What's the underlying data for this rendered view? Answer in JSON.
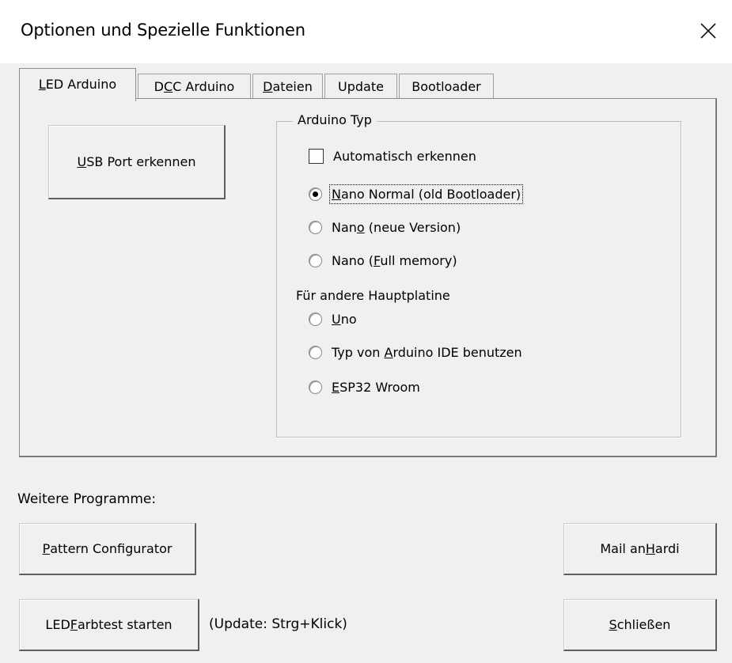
{
  "window": {
    "title": "Optionen und Spezielle Funktionen",
    "close_icon": "close-icon"
  },
  "tabs": [
    {
      "pre": "",
      "key": "L",
      "post": "ED Arduino",
      "active": true
    },
    {
      "pre": "D",
      "key": "C",
      "post": "C Arduino",
      "active": false
    },
    {
      "pre": "",
      "key": "D",
      "post": "ateien",
      "active": false
    },
    {
      "pre": "",
      "key": "",
      "post": "Update",
      "active": false
    },
    {
      "pre": "",
      "key": "",
      "post": "Bootloader",
      "active": false
    }
  ],
  "usb_button": {
    "pre": "",
    "key": "U",
    "post": "SB Port erkennen"
  },
  "arduino_type": {
    "legend": "Arduino Typ",
    "auto_detect": {
      "label": "Automatisch erkennen",
      "checked": false
    },
    "options": [
      {
        "pre": "",
        "key": "N",
        "post": "ano Normal (old Bootloader)",
        "checked": true
      },
      {
        "pre": "Nan",
        "key": "o",
        "post": " (neue Version)",
        "checked": false
      },
      {
        "pre": "Nano (",
        "key": "F",
        "post": "ull memory)",
        "checked": false
      }
    ],
    "other_label": "Für andere Hauptplatine",
    "other_options": [
      {
        "pre": "",
        "key": "U",
        "post": "no",
        "checked": false
      },
      {
        "pre": "Typ von ",
        "key": "A",
        "post": "rduino IDE benutzen",
        "checked": false
      },
      {
        "pre": "",
        "key": "E",
        "post": "SP32 Wroom",
        "checked": false
      }
    ]
  },
  "footer": {
    "more_programs_label": "Weitere Programme:",
    "pattern_button": {
      "pre": "",
      "key": "P",
      "post": "attern Configurator"
    },
    "mail_button": {
      "pre": "Mail an ",
      "key": "H",
      "post": "ardi"
    },
    "led_test_button": {
      "pre": "LED ",
      "key": "F",
      "post": "arbtest starten"
    },
    "update_hint": "(Update: Strg+Klick)",
    "close_button": {
      "pre": "",
      "key": "S",
      "post": "chließen"
    }
  }
}
